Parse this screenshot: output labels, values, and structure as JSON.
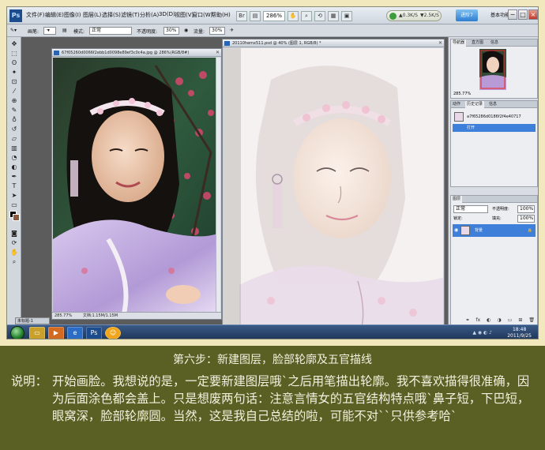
{
  "menubar": {
    "items": [
      "文件(F)",
      "编辑(E)",
      "图像(I)",
      "图层(L)",
      "选择(S)",
      "滤镜(T)",
      "分析(A)",
      "3D(D)",
      "视图(V)",
      "窗口(W)",
      "帮助(H)"
    ],
    "zoom": "286%",
    "speed_up": "0.3K/S",
    "speed_down": "2.5K/S",
    "qq_label": "进阶7",
    "workspace": "基本功能",
    "min_label": "−",
    "max_label": "□",
    "close_label": "×"
  },
  "options": {
    "mode_label": "模式:",
    "mode_value": "正常",
    "opacity_label": "不透明度:",
    "opacity_value": "30%",
    "flow_label": "流量:",
    "flow_value": "30%",
    "brush_label": "画笔:"
  },
  "doc_left": {
    "title": "67f05260d0066f2ebb1d0098e89ef3c0c4a.jpg @ 286%(RGB/8#)",
    "zoom": "285.77%",
    "doc_info": "文档:1.15M/1.15M"
  },
  "doc_right": {
    "title": "20110hemx511.psd @ 40% (图层 1, RGB/8) *",
    "zoom": "40%"
  },
  "panel_nav": {
    "tabs": [
      "导航器",
      "直方图",
      "信息"
    ],
    "zoom": "285.77%"
  },
  "panel_history": {
    "tabs": [
      "动作",
      "历史记录",
      "信息"
    ],
    "file_row": "a7f65286d0186f2f4e40717",
    "open_row": "打开"
  },
  "panel_layers": {
    "tabs": [
      "图层"
    ],
    "blend": "正常",
    "opacity_label": "不透明度:",
    "opacity_value": "100%",
    "lock_label": "锁定:",
    "fill_label": "填充:",
    "fill_value": "100%",
    "layer_name": "背景"
  },
  "taskbar": {
    "window_label": "未标题-1",
    "time": "18:48",
    "date": "2011/9/25"
  },
  "caption": {
    "title": "第六步：新建图层，脸部轮廓及五官描线",
    "label": "说明：",
    "body": "开始画脸。我想说的是，一定要新建图层哦`之后用笔描出轮廓。我不喜欢描得很准确，因为后面涂色都会盖上。只是想废两句话：注意言情女的五官结构特点哦`鼻子短，下巴短，眼窝深，脸部轮廓圆。当然，这是我自己总结的啦，可能不对``只供参考哈`"
  },
  "colors": {
    "caption_bg": "#5a5f24",
    "frame_bg": "#f1e9bd",
    "text_light": "#f4f0e0",
    "selection_blue": "#3d7fd9"
  }
}
